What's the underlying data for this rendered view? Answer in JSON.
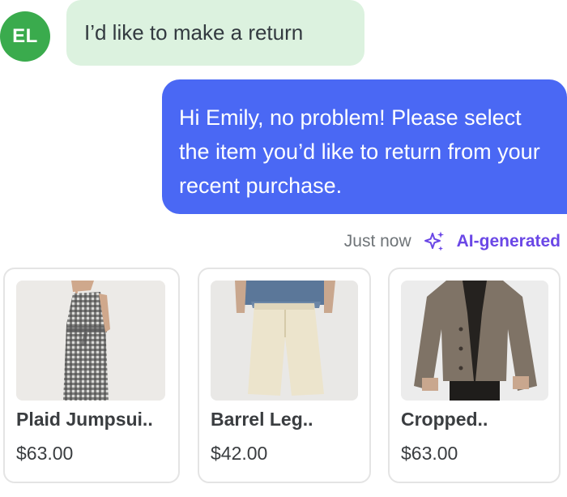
{
  "customer": {
    "avatar_initials": "EL",
    "message": "I’d like to make a return"
  },
  "agent": {
    "message": "Hi Emily, no problem! Please select the item you’d like to return from your recent purchase."
  },
  "meta": {
    "timestamp": "Just now",
    "ai_label": "AI-generated",
    "ai_icon": "sparkle-icon"
  },
  "products": [
    {
      "name": "Plaid Jumpsui..",
      "price": "$63.00",
      "image": "jumpsuit-photo"
    },
    {
      "name": "Barrel Leg..",
      "price": "$42.00",
      "image": "trousers-photo"
    },
    {
      "name": "Cropped..",
      "price": "$63.00",
      "image": "jacket-photo"
    }
  ],
  "colors": {
    "avatar": "#3aab4d",
    "customer_bubble": "#dcf2df",
    "agent_bubble": "#4a68f4",
    "ai_accent": "#6a47e6"
  }
}
